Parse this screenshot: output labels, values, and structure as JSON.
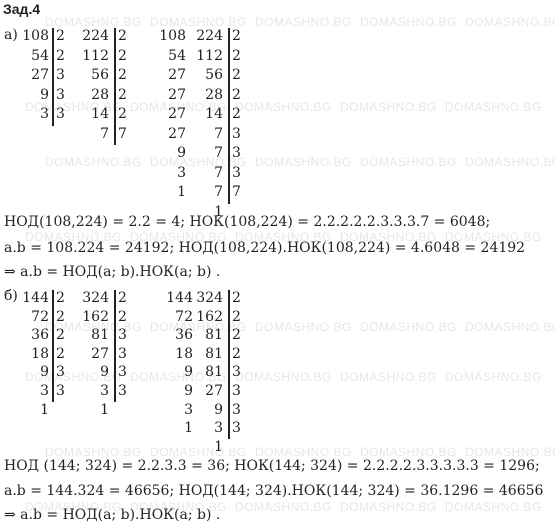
{
  "title": "Зад.4",
  "watermark": "DOMASHNO.BG",
  "part_a": {
    "label": "а)",
    "col1": {
      "numbers": [
        "108",
        "54",
        "27",
        "9",
        "3"
      ],
      "divisors": [
        "2",
        "2",
        "3",
        "3",
        "3"
      ]
    },
    "col2": {
      "numbers": [
        "224",
        "112",
        "56",
        "28",
        "14",
        "7"
      ],
      "divisors": [
        "2",
        "2",
        "2",
        "2",
        "2",
        "7"
      ]
    },
    "col3": {
      "numbers": [
        "108",
        "54",
        "27",
        "27",
        "27",
        "27",
        "9",
        "3",
        "1"
      ],
      "numbers2": [
        "224",
        "112",
        "56",
        "28",
        "14",
        "7",
        "7",
        "7",
        "7"
      ],
      "divisors": [
        "2",
        "2",
        "2",
        "2",
        "2",
        "3",
        "3",
        "3",
        "7"
      ],
      "extra": [
        "1"
      ]
    },
    "lines": [
      "НОД(108,224) = 2.2 = 4; НОК(108,224) = 2.2.2.2.2.3.3.3.7 = 6048;",
      "a.b = 108.224 = 24192; НОД(108,224).НОК(108,224) = 4.6048 = 24192",
      "⇒ a.b = НОД(a; b).НОК(a; b) ."
    ]
  },
  "part_b": {
    "label": "б)",
    "col1": {
      "numbers": [
        "144",
        "72",
        "36",
        "18",
        "9",
        "3",
        "1"
      ],
      "divisors": [
        "2",
        "2",
        "2",
        "2",
        "3",
        "3"
      ]
    },
    "col2": {
      "numbers": [
        "324",
        "162",
        "81",
        "27",
        "9",
        "3",
        "1"
      ],
      "divisors": [
        "2",
        "2",
        "3",
        "3",
        "3",
        "3"
      ]
    },
    "col3": {
      "numbers": [
        "144",
        "72",
        "36",
        "18",
        "9",
        "9",
        "3",
        "1"
      ],
      "numbers2": [
        "324",
        "162",
        "81",
        "81",
        "81",
        "27",
        "9",
        "3",
        "1"
      ],
      "divisors": [
        "2",
        "2",
        "2",
        "2",
        "3",
        "3",
        "3",
        "3"
      ]
    },
    "lines": [
      "НОД (144; 324) = 2.2.3.3 = 36; НОК(144; 324) = 2.2.2.2.3.3.3.3.3 = 1296;",
      "a.b = 144.324 = 46656; НОД(144; 324).НОК(144; 324) = 36.1296 = 46656",
      "⇒ a.b = НОД(a; b).НОК(a; b) ."
    ]
  }
}
